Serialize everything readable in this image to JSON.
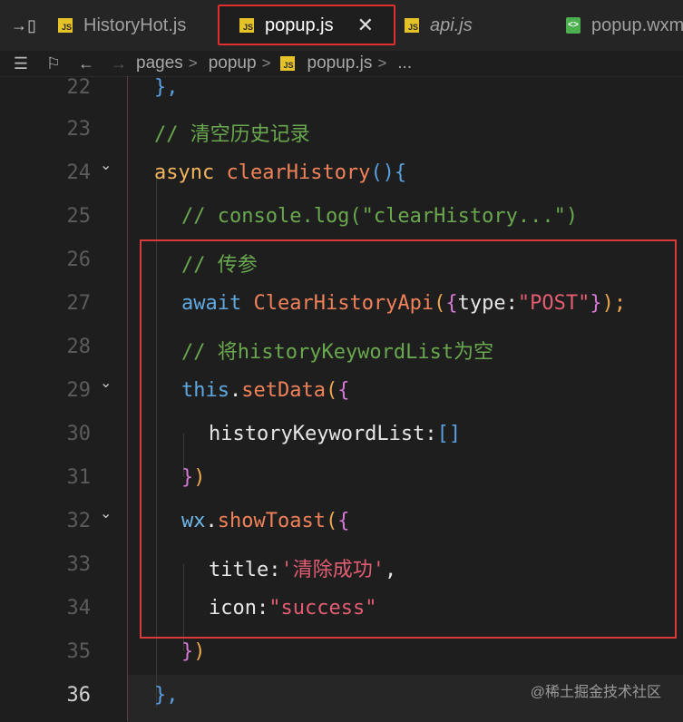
{
  "tabs": [
    {
      "label": "HistoryHot.js",
      "icon": "js-file-icon"
    },
    {
      "label": "popup.js",
      "icon": "js-file-icon",
      "active": true
    },
    {
      "label": "api.js",
      "icon": "js-file-icon"
    },
    {
      "label": "popup.wxm",
      "icon": "wxml-file-icon"
    }
  ],
  "toolbar": {
    "breadcrumb": [
      "pages",
      "popup",
      "popup.js",
      "..."
    ]
  },
  "lines": [
    {
      "n": "22",
      "tokens": [
        "},"
      ]
    },
    {
      "n": "23",
      "tokens": [
        "// 清空历史记录"
      ]
    },
    {
      "n": "24",
      "tokens": [
        "async ",
        "clearHistory",
        "(){"
      ]
    },
    {
      "n": "25",
      "tokens": [
        "// console.log(\"clearHistory...\")"
      ]
    },
    {
      "n": "26",
      "tokens": [
        "// 传参"
      ]
    },
    {
      "n": "27",
      "tokens": [
        "await ",
        "ClearHistoryApi",
        "(",
        "{",
        "type:",
        "\"POST\"",
        "}",
        ");"
      ]
    },
    {
      "n": "28",
      "tokens": [
        "// 将historyKeywordList为空"
      ]
    },
    {
      "n": "29",
      "tokens": [
        "this",
        ".",
        "setData",
        "(",
        "{"
      ]
    },
    {
      "n": "30",
      "tokens": [
        "historyKeywordList:",
        "[]"
      ]
    },
    {
      "n": "31",
      "tokens": [
        "}",
        ")"
      ]
    },
    {
      "n": "32",
      "tokens": [
        "wx",
        ".",
        "showToast",
        "(",
        "{"
      ]
    },
    {
      "n": "33",
      "tokens": [
        "title:",
        "'清除成功'",
        ","
      ]
    },
    {
      "n": "34",
      "tokens": [
        "icon:",
        "\"success\""
      ]
    },
    {
      "n": "35",
      "tokens": [
        "}",
        ")"
      ]
    },
    {
      "n": "36",
      "tokens": [
        "},"
      ]
    }
  ],
  "watermark": "@稀土掘金技术社区",
  "colors": {
    "highlight": "#d93a3a",
    "background": "#1e1e1e"
  }
}
